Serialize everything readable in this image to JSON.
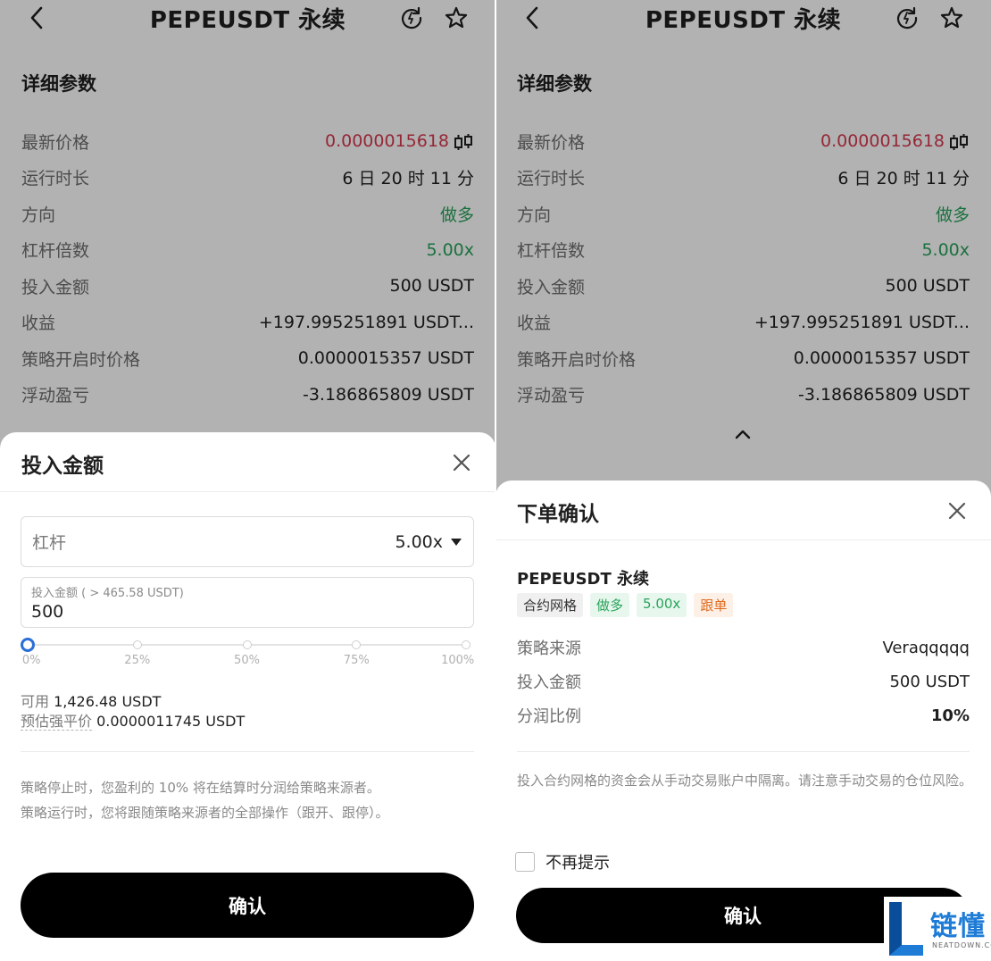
{
  "header": {
    "title": "PEPEUSDT 永续"
  },
  "details": {
    "section_title": "详细参数",
    "rows": [
      {
        "label": "最新价格",
        "value": "0.0000015618"
      },
      {
        "label": "运行时长",
        "value": "6 日 20 时 11 分"
      },
      {
        "label": "方向",
        "value": "做多"
      },
      {
        "label": "杠杆倍数",
        "value": "5.00x"
      },
      {
        "label": "投入金额",
        "value": "500 USDT"
      },
      {
        "label": "收益",
        "value": "+197.995251891 USDT..."
      },
      {
        "label": "策略开启时价格",
        "value": "0.0000015357 USDT"
      },
      {
        "label": "浮动盈亏",
        "value": "-3.186865809 USDT"
      }
    ]
  },
  "colors": {
    "price_red": "#d6394f",
    "long_green": "#27a35a",
    "slider_blue": "#2a6fd6",
    "brand_blue": "#1e7cd6"
  },
  "icons": [
    "back-icon",
    "refresh-icon",
    "star-icon",
    "candlestick-icon",
    "close-icon",
    "chevron-up-icon",
    "dropdown-arrow-icon"
  ],
  "invest_sheet": {
    "title": "投入金额",
    "leverage_label": "杠杆",
    "leverage_value": "5.00x",
    "amount_hint": "投入金额 ( > 465.58 USDT)",
    "amount_value": "500",
    "slider_ticks": [
      "0%",
      "25%",
      "50%",
      "75%",
      "100%"
    ],
    "slider_position": 0,
    "available_label": "可用",
    "available_value": "1,426.48 USDT",
    "liq_label": "预估强平价",
    "liq_value": "0.0000011745 USDT",
    "note_line1": "策略停止时，您盈利的 10% 将在结算时分润给策略来源者。",
    "note_line2": "策略运行时，您将跟随策略来源者的全部操作（跟开、跟停）。",
    "confirm_label": "确认"
  },
  "order_sheet": {
    "title": "下单确认",
    "pair": "PEPEUSDT 永续",
    "tags": [
      "合约网格",
      "做多",
      "5.00x",
      "跟单"
    ],
    "rows": [
      {
        "label": "策略来源",
        "value": "Veraqqqqq"
      },
      {
        "label": "投入金额",
        "value": "500 USDT"
      },
      {
        "label": "分润比例",
        "value": "10%"
      }
    ],
    "note": "投入合约网格的资金会从手动交易账户中隔离。请注意手动交易的仓位风险。",
    "dont_remind_label": "不再提示",
    "confirm_label": "确认"
  },
  "watermark": {
    "text": "链懂",
    "sub": "NEATDOWN.COM"
  }
}
